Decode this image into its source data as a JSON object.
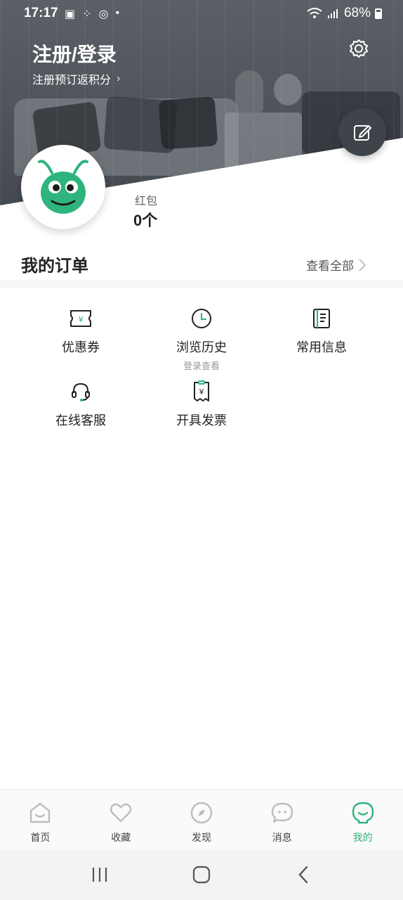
{
  "status_bar": {
    "time": "17:17",
    "battery": "68%"
  },
  "header": {
    "title": "注册/登录",
    "subtitle": "注册预订返积分"
  },
  "wallet": {
    "red_packet_label": "红包",
    "red_packet_value": "0个"
  },
  "orders": {
    "title": "我的订单",
    "view_all": "查看全部"
  },
  "services": [
    {
      "label": "优惠券",
      "icon": "coupon-icon",
      "sub": ""
    },
    {
      "label": "浏览历史",
      "icon": "history-clock-icon",
      "sub": "登录查看"
    },
    {
      "label": "常用信息",
      "icon": "notebook-icon",
      "sub": ""
    },
    {
      "label": "在线客服",
      "icon": "headset-icon",
      "sub": ""
    },
    {
      "label": "开具发票",
      "icon": "invoice-icon",
      "sub": ""
    }
  ],
  "tabbar": [
    {
      "label": "首页",
      "icon": "home-icon",
      "active": false
    },
    {
      "label": "收藏",
      "icon": "heart-icon",
      "active": false
    },
    {
      "label": "发现",
      "icon": "compass-icon",
      "active": false
    },
    {
      "label": "消息",
      "icon": "message-icon",
      "active": false
    },
    {
      "label": "我的",
      "icon": "profile-icon",
      "active": true
    }
  ],
  "colors": {
    "accent": "#2fb47e",
    "header_dark": "#4f535a",
    "text_primary": "#222222",
    "text_secondary": "#999999"
  }
}
